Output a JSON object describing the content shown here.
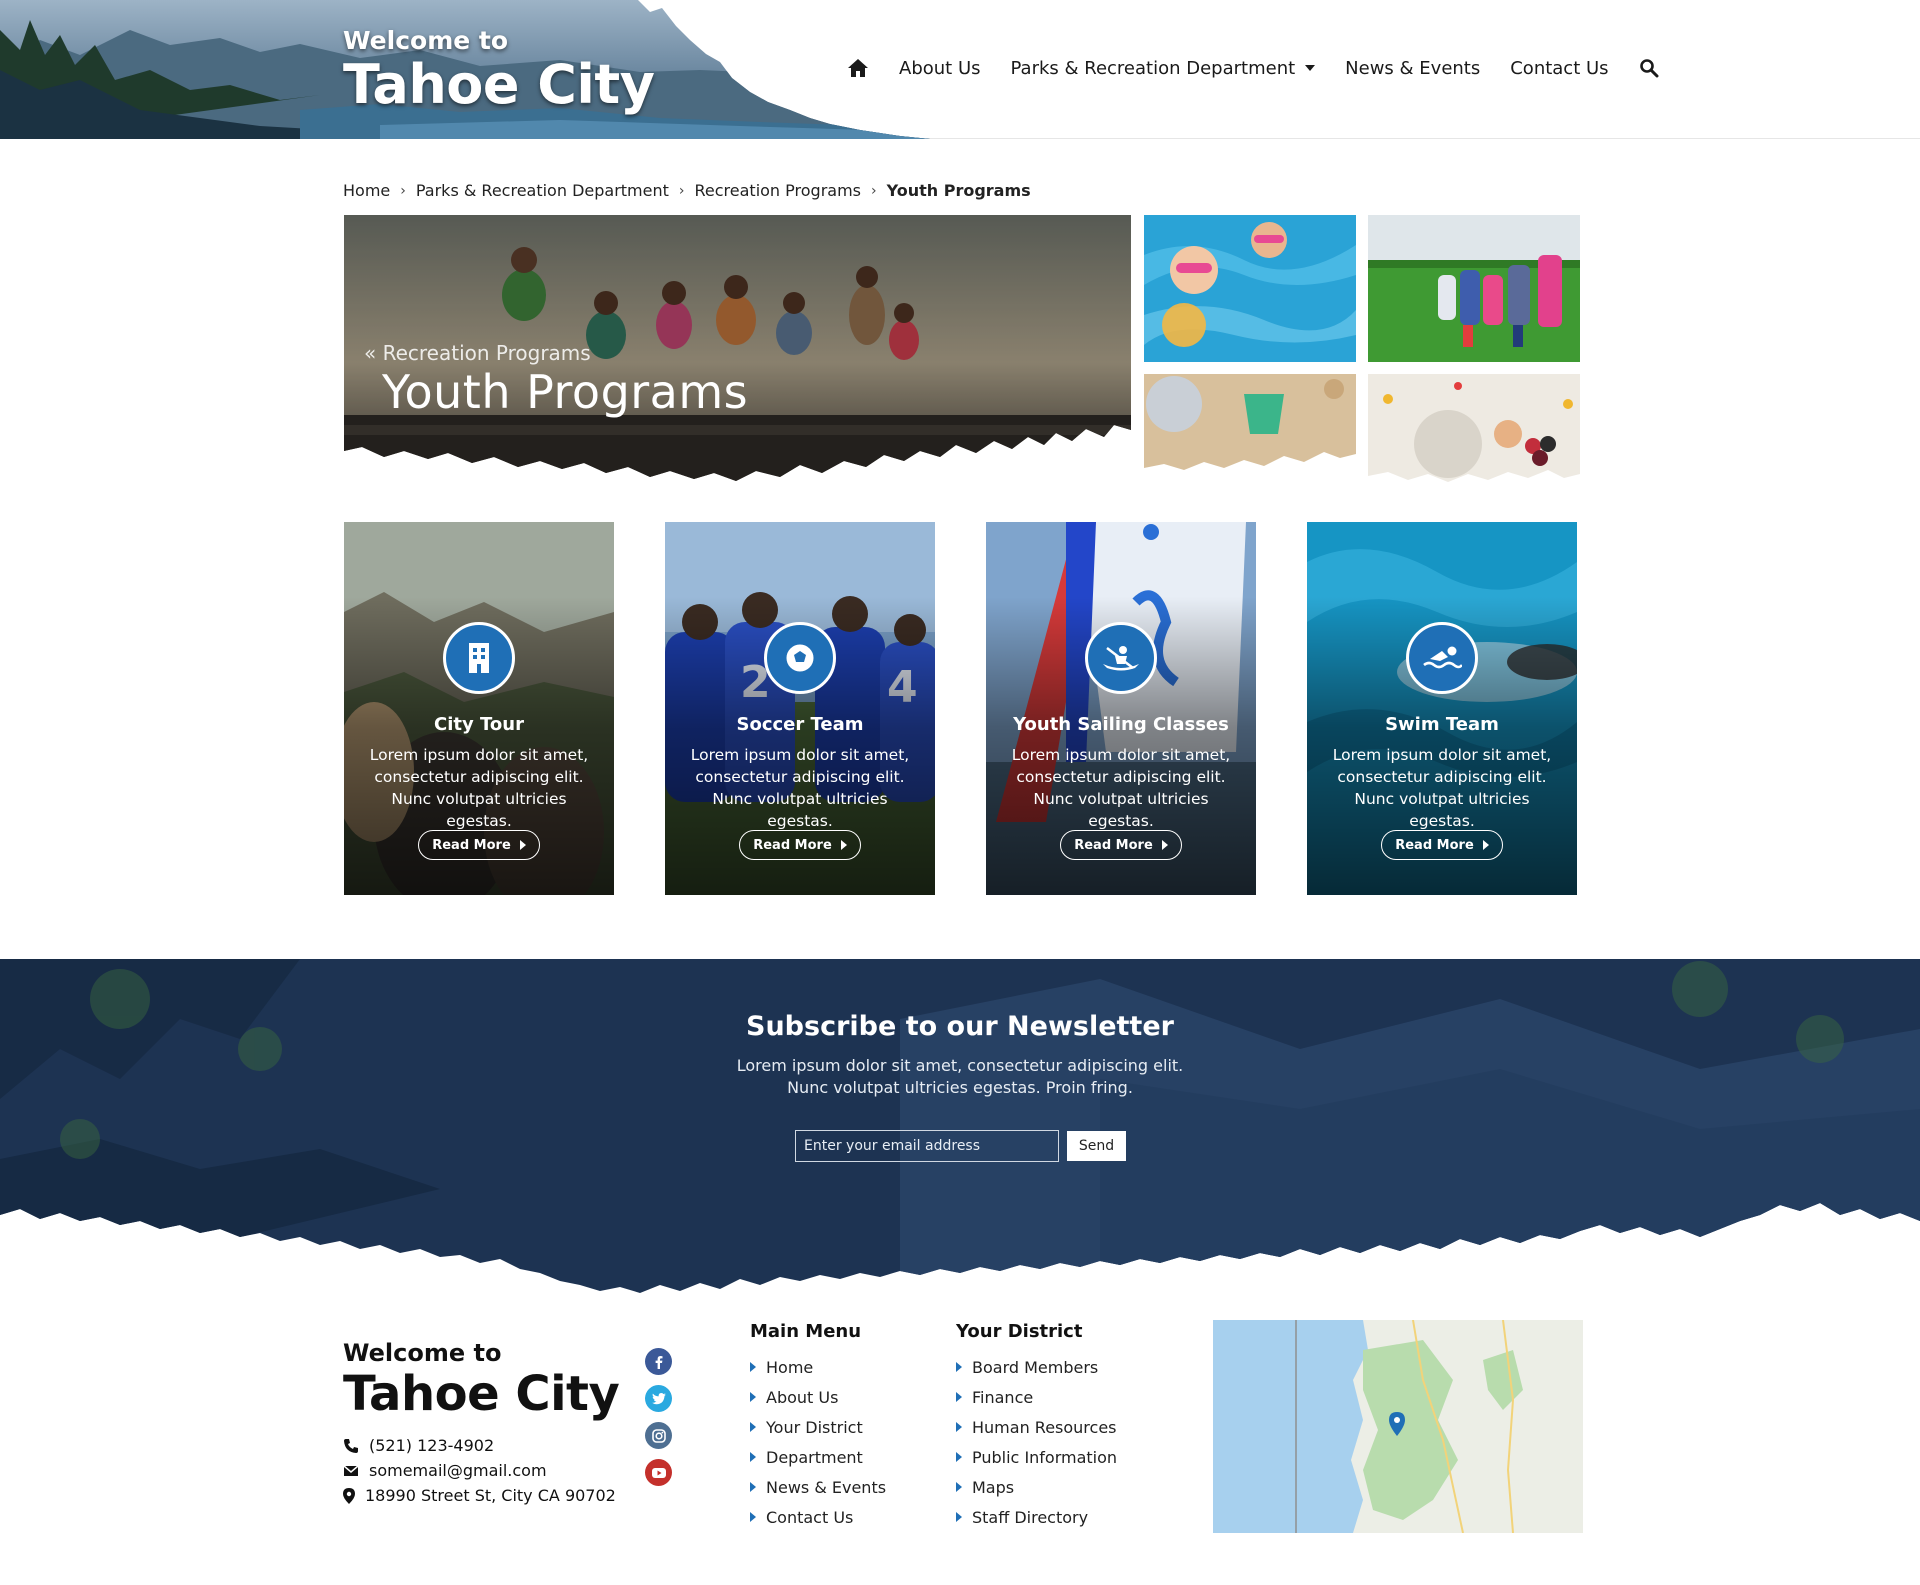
{
  "header": {
    "brand_small": "Welcome to",
    "brand_big": "Tahoe City",
    "nav": {
      "home_icon": "home-icon",
      "about": "About Us",
      "parks": "Parks & Recreation Department",
      "news": "News & Events",
      "contact": "Contact Us",
      "search_icon": "search-icon"
    }
  },
  "breadcrumb": {
    "home": "Home",
    "parks": "Parks & Recreation Department",
    "recreation": "Recreation Programs",
    "current": "Youth Programs"
  },
  "hero": {
    "back_label": "« Recreation Programs",
    "title": "Youth Programs"
  },
  "cards": [
    {
      "title": "City Tour",
      "text": "Lorem ipsum dolor sit amet, consectetur adipiscing elit. Nunc volutpat ultricies egestas.",
      "button": "Read More",
      "icon": "building-icon"
    },
    {
      "title": "Soccer Team",
      "text": "Lorem ipsum dolor sit amet, consectetur adipiscing elit. Nunc volutpat ultricies egestas.",
      "button": "Read More",
      "icon": "soccer-ball-icon"
    },
    {
      "title": "Youth Sailing Classes",
      "text": "Lorem ipsum dolor sit amet, consectetur adipiscing elit. Nunc volutpat ultricies egestas.",
      "button": "Read More",
      "icon": "kayak-icon"
    },
    {
      "title": "Swim Team",
      "text": "Lorem ipsum dolor sit amet, consectetur adipiscing elit. Nunc volutpat ultricies egestas.",
      "button": "Read More",
      "icon": "swimmer-icon"
    }
  ],
  "newsletter": {
    "title": "Subscribe to our Newsletter",
    "line1": "Lorem ipsum dolor sit amet, consectetur adipiscing elit.",
    "line2": "Nunc volutpat ultricies egestas. Proin fring.",
    "placeholder": "Enter your email address",
    "send": "Send"
  },
  "footer": {
    "brand_small": "Welcome to",
    "brand_big": "Tahoe City",
    "phone": "(521) 123-4902",
    "email": "somemail@gmail.com",
    "address": "18990 Street St, City CA 90702",
    "social": [
      "facebook-icon",
      "twitter-icon",
      "instagram-icon",
      "youtube-icon"
    ],
    "main_menu": {
      "heading": "Main Menu",
      "items": [
        "Home",
        "About Us",
        "Your District",
        "Department",
        "News & Events",
        "Contact Us"
      ]
    },
    "your_district": {
      "heading": "Your District",
      "items": [
        "Board Members",
        "Finance",
        "Human Resources",
        "Public Information",
        "Maps",
        "Staff Directory"
      ]
    }
  },
  "colors": {
    "accent": "#1f6fb6",
    "newsletter_bg": "#1d3352",
    "facebook": "#3b5998",
    "twitter": "#1da1f2",
    "instagram": "#4e6f92",
    "youtube": "#c4302b"
  }
}
